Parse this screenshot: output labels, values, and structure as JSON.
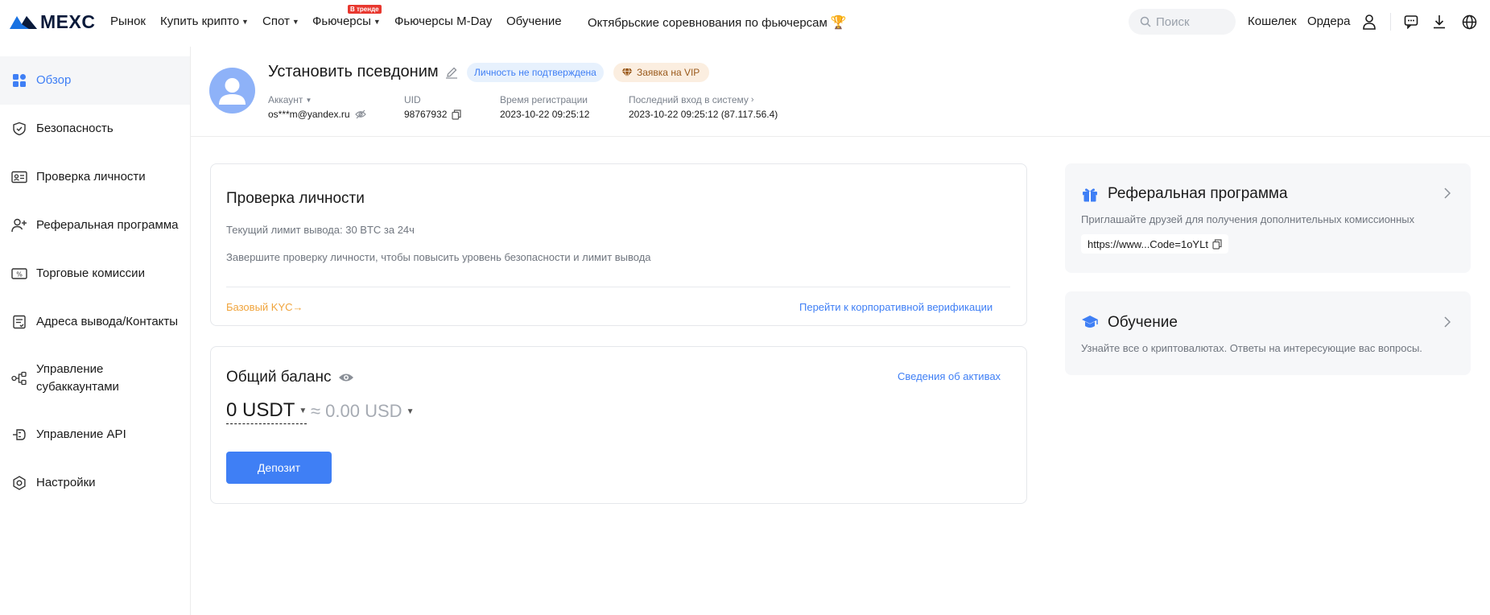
{
  "brand": {
    "name": "MEXC"
  },
  "nav": {
    "market": "Рынок",
    "buy_crypto": "Купить крипто",
    "spot": "Спот",
    "futures": "Фьючерсы",
    "futures_badge": "В тренде",
    "futures_mday": "Фьючерсы M-Day",
    "learning": "Обучение",
    "contest": "Октябрьские соревнования по фьючерсам",
    "search_placeholder": "Поиск",
    "wallet": "Кошелек",
    "orders": "Ордера"
  },
  "icons": {
    "user": "user-icon",
    "chat": "chat-icon",
    "download": "download-icon",
    "globe": "globe-icon",
    "trophy": "trophy-icon"
  },
  "sidebar": {
    "items": [
      {
        "label": "Обзор",
        "icon": "overview-icon",
        "active": true
      },
      {
        "label": "Безопасность",
        "icon": "shield-icon"
      },
      {
        "label": "Проверка личности",
        "icon": "id-card-icon"
      },
      {
        "label": "Реферальная программа",
        "icon": "add-user-icon"
      },
      {
        "label": "Торговые комиссии",
        "icon": "fee-icon"
      },
      {
        "label": "Адреса вывода/Контакты",
        "icon": "address-book-icon"
      },
      {
        "label": "Управление субаккаунтами",
        "icon": "sub-account-icon"
      },
      {
        "label": "Управление API",
        "icon": "api-icon"
      },
      {
        "label": "Настройки",
        "icon": "settings-icon"
      }
    ]
  },
  "profile": {
    "nickname": "Установить псевдоним",
    "identity_status": "Личность не подтверждена",
    "vip_application": "Заявка на VIP",
    "account_label": "Аккаунт",
    "account_value": "os***m@yandex.ru",
    "uid_label": "UID",
    "uid_value": "98767932",
    "reg_time_label": "Время регистрации",
    "reg_time_value": "2023-10-22 09:25:12",
    "last_login_label": "Последний вход в систему",
    "last_login_value": "2023-10-22 09:25:12 (87.117.56.4)"
  },
  "kyc": {
    "title": "Проверка личности",
    "limit_text": "Текущий лимит вывода: 30 BTC за 24ч",
    "prompt_text": "Завершите проверку личности, чтобы повысить уровень безопасности и лимит вывода",
    "basic_kyc": "Базовый KYC→",
    "corporate_link": "Перейти к корпоративной верификации"
  },
  "balance": {
    "title": "Общий баланс",
    "details_link": "Сведения об активах",
    "amount": "0 USDT",
    "approx": "≈ 0.00 USD",
    "deposit_label": "Депозит"
  },
  "referral": {
    "title": "Реферальная программа",
    "text": "Приглашайте друзей для получения дополнительных комиссионных",
    "link": "https://www...Code=1oYLt"
  },
  "education": {
    "title": "Обучение",
    "text": "Узнайте все о криптовалютах. Ответы на интересующие вас вопросы."
  },
  "colors": {
    "accent": "#3f7ff5",
    "warning": "#f0a43c",
    "vip_text": "#9a5a1c",
    "badge_red": "#e8382f"
  }
}
